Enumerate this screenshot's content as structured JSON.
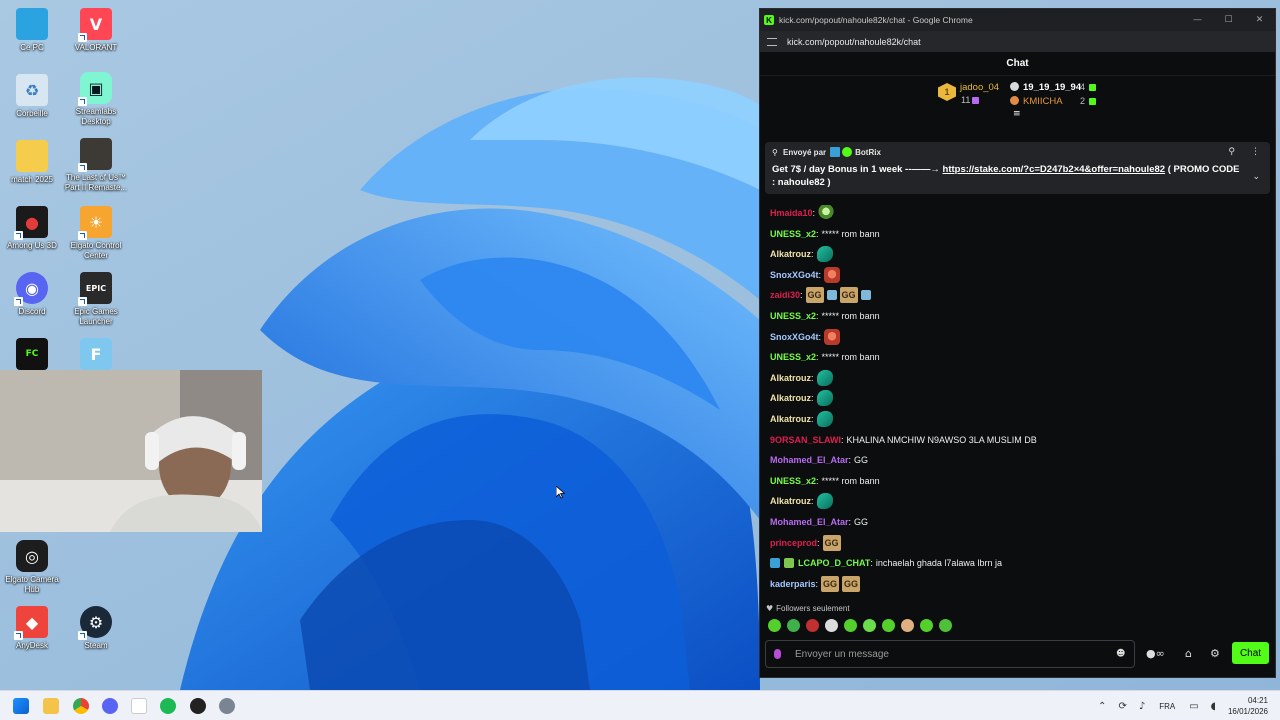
{
  "desktop": {
    "icons": [
      {
        "label": "Ce PC",
        "icon": "monitor-icon"
      },
      {
        "label": "VALORANT",
        "icon": "valorant-icon"
      },
      {
        "label": "Corbeille",
        "icon": "recycle-bin-icon"
      },
      {
        "label": "Streamlabs Desktop",
        "icon": "streamlabs-icon"
      },
      {
        "label": "match 2025",
        "icon": "folder-icon"
      },
      {
        "label": "The Last of Us™ Part II Remaste...",
        "icon": "game-icon"
      },
      {
        "label": "Among Us 3D",
        "icon": "among-us-icon"
      },
      {
        "label": "Elgato Control Center",
        "icon": "elgato-icon"
      },
      {
        "label": "Discord",
        "icon": "discord-icon"
      },
      {
        "label": "Epic Games Launcher",
        "icon": "epic-icon"
      },
      {
        "label": "Elgato Camera Hub",
        "icon": "camera-hub-icon"
      },
      {
        "label": "AnyDesk",
        "icon": "anydesk-icon"
      },
      {
        "label": "Steam",
        "icon": "steam-icon"
      }
    ]
  },
  "browser": {
    "title": "kick.com/popout/nahoule82k/chat - Google Chrome",
    "url": "kick.com/popout/nahoule82k/chat",
    "controls": {
      "minimize": "—",
      "maximize": "☐",
      "close": "✕"
    }
  },
  "chat": {
    "header": "Chat",
    "leaderboard": {
      "first": {
        "rank": "1",
        "name": "jadoo_04",
        "count": "11"
      },
      "second": {
        "name": "19_19_19_94",
        "count": "4"
      },
      "third": {
        "name": "KMIICHA",
        "count": "2"
      }
    },
    "pinned": {
      "sent_by": "Envoyé par",
      "bot": "BotRix",
      "message_start": "Get 7$ / day Bonus in 1 week --——→ ",
      "link": "https://stake.com/?c=D247b2×4&offer=nahoule82",
      "message_end": " ( PROMO CODE : nahoule82 )"
    },
    "messages": [
      {
        "user": "Hmaida10",
        "color": "#e01f4f",
        "text": "",
        "emotes": [
          "alien"
        ]
      },
      {
        "user": "UNESS_x2",
        "color": "#75fd46",
        "text": "***** rom bann",
        "emotes": []
      },
      {
        "user": "Alkatrouz",
        "color": "#f2e4a7",
        "text": "",
        "emotes": [
          "teal"
        ]
      },
      {
        "user": "SnoxXGo4t",
        "color": "#a6c8ff",
        "text": "",
        "emotes": [
          "red"
        ]
      },
      {
        "user": "zaidi30",
        "color": "#e01f4f",
        "text": "",
        "emotes": [
          "gg",
          "small",
          "gg",
          "small"
        ]
      },
      {
        "user": "UNESS_x2",
        "color": "#75fd46",
        "text": "***** rom bann",
        "emotes": []
      },
      {
        "user": "SnoxXGo4t",
        "color": "#a6c8ff",
        "text": "",
        "emotes": [
          "red"
        ]
      },
      {
        "user": "UNESS_x2",
        "color": "#75fd46",
        "text": "***** rom bann",
        "emotes": []
      },
      {
        "user": "Alkatrouz",
        "color": "#f2e4a7",
        "text": "",
        "emotes": [
          "teal"
        ]
      },
      {
        "user": "Alkatrouz",
        "color": "#f2e4a7",
        "text": "",
        "emotes": [
          "teal"
        ]
      },
      {
        "user": "Alkatrouz",
        "color": "#f2e4a7",
        "text": "",
        "emotes": [
          "teal"
        ]
      },
      {
        "user": "9ORSAN_SLAWI",
        "color": "#e01f4f",
        "text": "KHALINA NMCHIW N9AWSO 3LA MUSLIM DB",
        "emotes": []
      },
      {
        "user": "Mohamed_El_Atar",
        "color": "#b86bf2",
        "text": "GG",
        "emotes": []
      },
      {
        "user": "UNESS_x2",
        "color": "#75fd46",
        "text": "***** rom bann",
        "emotes": []
      },
      {
        "user": "Alkatrouz",
        "color": "#f2e4a7",
        "text": "",
        "emotes": [
          "teal"
        ]
      },
      {
        "user": "Mohamed_El_Atar",
        "color": "#b86bf2",
        "text": "GG",
        "emotes": []
      },
      {
        "user": "princeprod",
        "color": "#e01f4f",
        "text": "",
        "emotes": [
          "gg"
        ]
      },
      {
        "user": "LCAPO_D_CHAT",
        "color": "#75fd46",
        "text": "inchaelah ghada l7alawa lbrn ja",
        "emotes": [],
        "badges": true
      },
      {
        "user": "kaderparis",
        "color": "#a6c8ff",
        "text": "",
        "emotes": [
          "gg",
          "gg"
        ]
      }
    ],
    "followers_only": "Followers seulement",
    "input_placeholder": "Envoyer un message",
    "send_button": "Chat"
  },
  "taskbar": {
    "language": "FRA",
    "time": "04:21",
    "date": "16/01/2026"
  },
  "colors": {
    "kick_green": "#53fc18",
    "chat_bg": "#0b0d0f",
    "taskbar_bg": "#eef2f8"
  }
}
